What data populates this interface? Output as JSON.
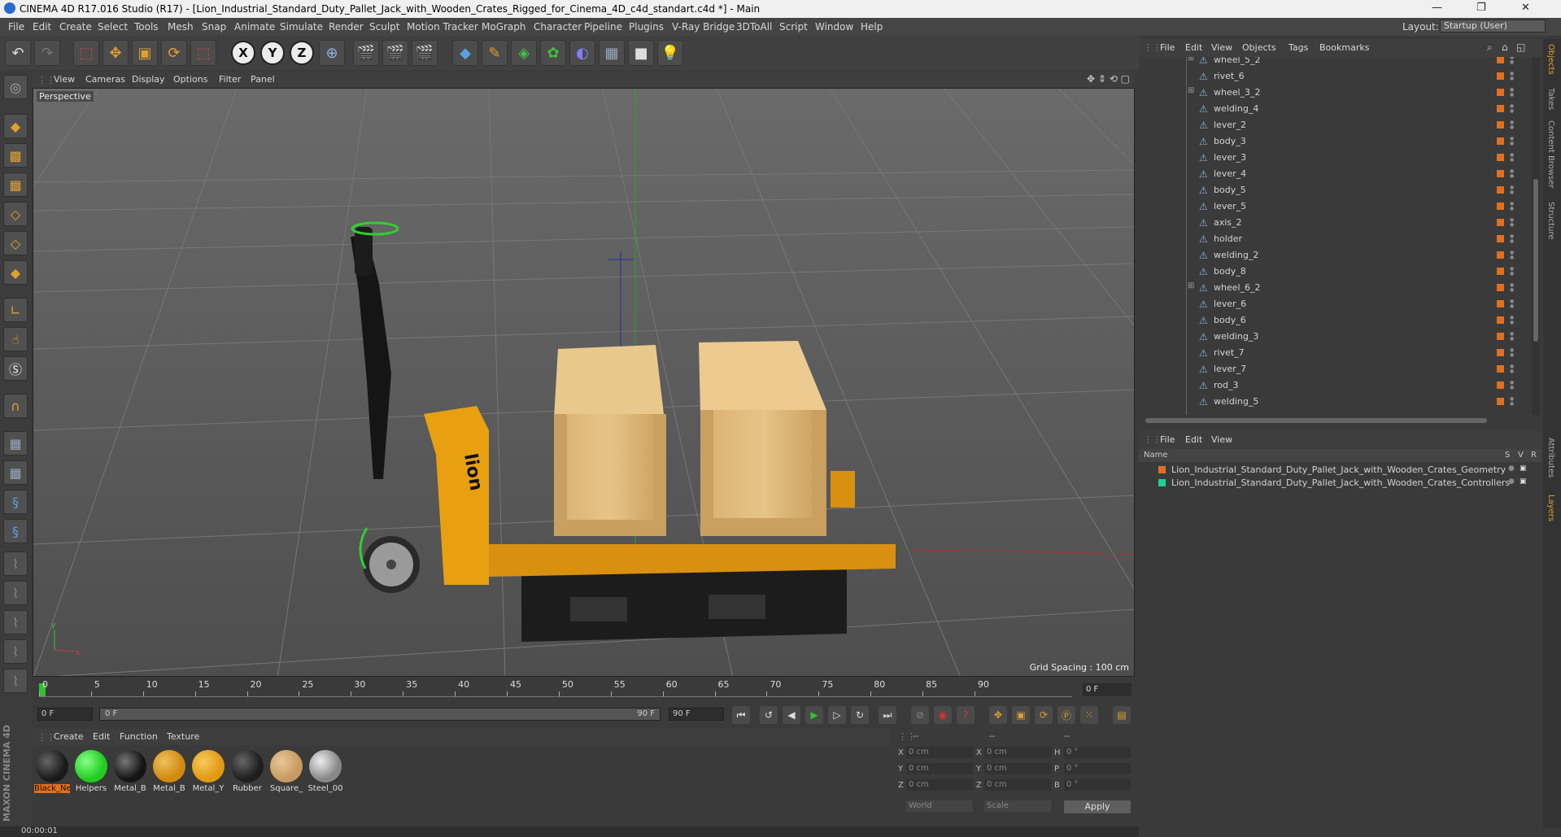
{
  "window": {
    "title": "CINEMA 4D R17.016 Studio (R17) - [Lion_Industrial_Standard_Duty_Pallet_Jack_with_Wooden_Crates_Rigged_for_Cinema_4D_c4d_standart.c4d *] - Main",
    "minimize": "—",
    "maximize": "❐",
    "close": "✕"
  },
  "menubar": {
    "items": [
      "File",
      "Edit",
      "Create",
      "Select",
      "Tools",
      "Mesh",
      "Snap",
      "Animate",
      "Simulate",
      "Render",
      "Sculpt",
      "Motion Tracker",
      "MoGraph",
      "Character",
      "Pipeline",
      "Plugins",
      "V-Ray Bridge",
      "3DToAll",
      "Script",
      "Window",
      "Help"
    ],
    "layout_label": "Layout:",
    "layout_value": "Startup (User)"
  },
  "toolbar": {
    "axis_x": "X",
    "axis_y": "Y",
    "axis_z": "Z"
  },
  "viewport": {
    "menu": [
      "View",
      "Cameras",
      "Display",
      "Options",
      "Filter",
      "Panel"
    ],
    "label": "Perspective",
    "grid_spacing": "Grid Spacing : 100 cm",
    "logo_text": "lion"
  },
  "timeline": {
    "ticks": [
      "0",
      "5",
      "10",
      "15",
      "20",
      "25",
      "30",
      "35",
      "40",
      "45",
      "50",
      "55",
      "60",
      "65",
      "70",
      "75",
      "80",
      "85",
      "90"
    ],
    "current_frame": "0 F",
    "start_field": "0 F",
    "range_start": "0 F",
    "range_end": "90 F",
    "end_field": "90 F"
  },
  "material_manager": {
    "menu": [
      "Create",
      "Edit",
      "Function",
      "Texture"
    ],
    "materials": [
      {
        "label": "Black_Ne",
        "color": "#1a1a1a",
        "selected": true
      },
      {
        "label": "Helpers",
        "color": "#22cc22",
        "selected": false
      },
      {
        "label": "Metal_B",
        "color": "#141414",
        "selected": false
      },
      {
        "label": "Metal_B",
        "color": "#d08a10",
        "selected": false
      },
      {
        "label": "Metal_Y",
        "color": "#e09a10",
        "selected": false
      },
      {
        "label": "Rubber",
        "color": "#1e1e1e",
        "selected": false
      },
      {
        "label": "Square_",
        "color": "#c89a60",
        "selected": false
      },
      {
        "label": "Steel_00",
        "color": "#888888",
        "selected": false
      }
    ]
  },
  "coordinates": {
    "header": [
      "--",
      "--",
      "--"
    ],
    "rows": [
      {
        "l1": "X",
        "v1": "0 cm",
        "l2": "X",
        "v2": "0 cm",
        "l3": "H",
        "v3": "0 °"
      },
      {
        "l1": "Y",
        "v1": "0 cm",
        "l2": "Y",
        "v2": "0 cm",
        "l3": "P",
        "v3": "0 °"
      },
      {
        "l1": "Z",
        "v1": "0 cm",
        "l2": "Z",
        "v2": "0 cm",
        "l3": "B",
        "v3": "0 °"
      }
    ],
    "mode_world": "World",
    "mode_scale": "Scale",
    "apply": "Apply"
  },
  "status": {
    "time": "00:00:01"
  },
  "maxon_logo": "MAXON CINEMA 4D",
  "object_manager": {
    "menu": [
      "File",
      "Edit",
      "View",
      "Objects",
      "Tags",
      "Bookmarks"
    ],
    "items": [
      {
        "name": "wheel_5_2",
        "expandable": true
      },
      {
        "name": "rivet_6",
        "expandable": false
      },
      {
        "name": "wheel_3_2",
        "expandable": true
      },
      {
        "name": "welding_4",
        "expandable": false
      },
      {
        "name": "lever_2",
        "expandable": false
      },
      {
        "name": "body_3",
        "expandable": false
      },
      {
        "name": "lever_3",
        "expandable": false
      },
      {
        "name": "lever_4",
        "expandable": false
      },
      {
        "name": "body_5",
        "expandable": false
      },
      {
        "name": "lever_5",
        "expandable": false
      },
      {
        "name": "axis_2",
        "expandable": false
      },
      {
        "name": "holder",
        "expandable": false
      },
      {
        "name": "welding_2",
        "expandable": false
      },
      {
        "name": "body_8",
        "expandable": false
      },
      {
        "name": "wheel_6_2",
        "expandable": true
      },
      {
        "name": "lever_6",
        "expandable": false
      },
      {
        "name": "body_6",
        "expandable": false
      },
      {
        "name": "welding_3",
        "expandable": false
      },
      {
        "name": "rivet_7",
        "expandable": false
      },
      {
        "name": "lever_7",
        "expandable": false
      },
      {
        "name": "rod_3",
        "expandable": false
      },
      {
        "name": "welding_5",
        "expandable": false
      }
    ]
  },
  "layer_manager": {
    "menu": [
      "File",
      "Edit",
      "View"
    ],
    "columns": [
      "Name",
      "S",
      "V",
      "R"
    ],
    "layers": [
      {
        "name": "Lion_Industrial_Standard_Duty_Pallet_Jack_with_Wooden_Crates_Geometry",
        "color": "#e07020"
      },
      {
        "name": "Lion_Industrial_Standard_Duty_Pallet_Jack_with_Wooden_Crates_Controllers",
        "color": "#20d090"
      }
    ]
  },
  "right_tabs": [
    "Objects",
    "Takes",
    "Content Browser",
    "Structure",
    "Attributes",
    "Layers"
  ],
  "colors": {
    "accent_orange": "#e07020",
    "play_green": "#30c030",
    "pallet_yellow": "#e8a010"
  }
}
